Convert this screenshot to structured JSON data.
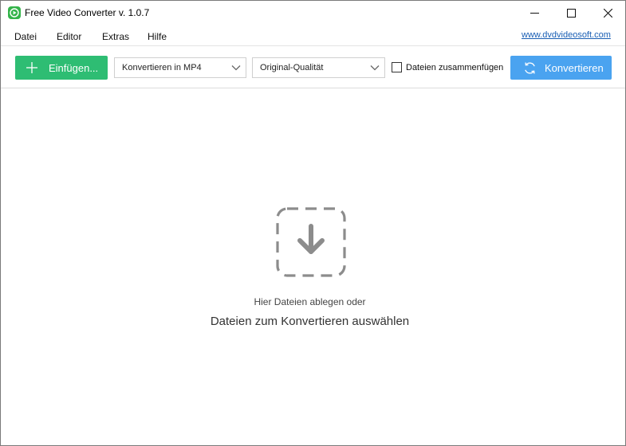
{
  "window": {
    "title": "Free Video Converter v. 1.0.7",
    "app_icon": "play-icon",
    "controls": [
      "minimize-icon",
      "maximize-icon",
      "close-icon"
    ]
  },
  "menu": {
    "items": [
      "Datei",
      "Editor",
      "Extras",
      "Hilfe"
    ],
    "site_link": "www.dvdvideosoft.com"
  },
  "toolbar": {
    "add_label": "Einfügen...",
    "format_value": "Konvertieren in MP4",
    "quality_value": "Original-Qualität",
    "merge_label": "Dateien zusammenfügen",
    "merge_checked": false,
    "convert_label": "Konvertieren"
  },
  "dropzone": {
    "line1": "Hier Dateien ablegen oder",
    "line2": "Dateien zum Konvertieren auswählen",
    "icon": "download-arrow-icon"
  },
  "colors": {
    "add_button": "#2ebd73",
    "convert_button": "#4aa3f0",
    "link": "#1a5fb4",
    "drop_icon": "#8c8c8c"
  }
}
